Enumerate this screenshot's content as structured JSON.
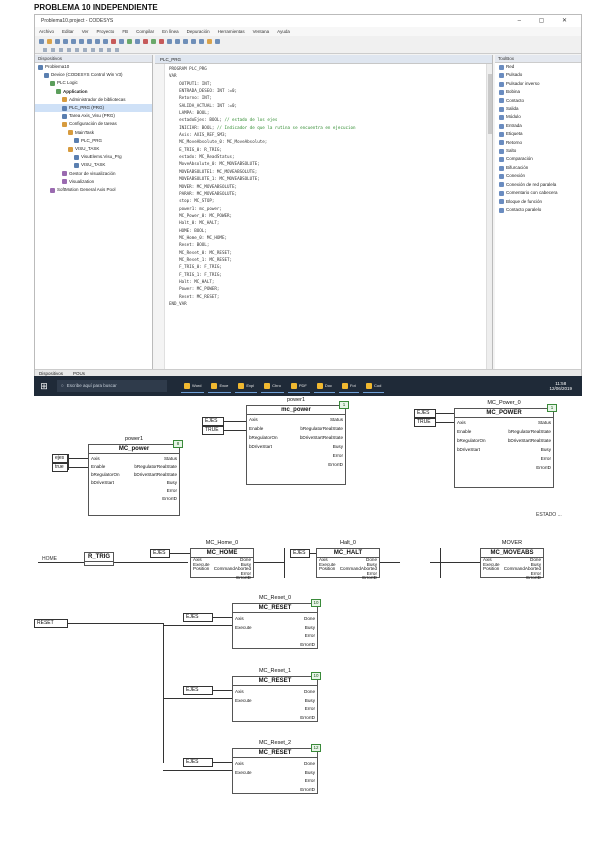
{
  "page_title": "PROBLEMA 10 INDEPENDIENTE",
  "ide": {
    "window_title": "Problema10.project - CODESYS",
    "window_controls": "–  ▢  ✕",
    "menu": [
      "Archivo",
      "Editar",
      "Ver",
      "Proyecto",
      "FB",
      "Compilar",
      "En línea",
      "Depuración",
      "Herramientas",
      "Ventana",
      "Ayuda"
    ],
    "devices_header": "Dispositivos",
    "tree": [
      {
        "label": "Problema10",
        "indent": 0,
        "icon": "project-icon",
        "bold": false
      },
      {
        "label": "Device (CODESYS Control Win V3)",
        "indent": 1,
        "icon": "plc-icon",
        "bold": false
      },
      {
        "label": "PLC Logic",
        "indent": 2,
        "icon": "logic-icon",
        "bold": false
      },
      {
        "label": "Application",
        "indent": 3,
        "icon": "app-icon",
        "bold": true
      },
      {
        "label": "Administrador de bibliotecas",
        "indent": 4,
        "icon": "library-icon",
        "bold": false
      },
      {
        "label": "PLC_PRG (PRG)",
        "indent": 4,
        "icon": "program-icon",
        "bold": false,
        "selected": true
      },
      {
        "label": "Tarea Axis_Visu (PRG)",
        "indent": 4,
        "icon": "program-icon",
        "bold": false
      },
      {
        "label": "Configuración de tareas",
        "indent": 4,
        "icon": "task-icon",
        "bold": false
      },
      {
        "label": "MainTask",
        "indent": 5,
        "icon": "task-icon",
        "bold": false
      },
      {
        "label": "PLC_PRG",
        "indent": 6,
        "icon": "program-icon",
        "bold": false
      },
      {
        "label": "VISU_TASK",
        "indent": 5,
        "icon": "task-icon",
        "bold": false
      },
      {
        "label": "VisuElems.Visu_Prg",
        "indent": 6,
        "icon": "program-icon",
        "bold": false
      },
      {
        "label": "VISU_TASK",
        "indent": 6,
        "icon": "program-icon",
        "bold": false
      },
      {
        "label": "Gestor de visualización",
        "indent": 4,
        "icon": "visu-icon",
        "bold": false
      },
      {
        "label": "Visualization",
        "indent": 4,
        "icon": "visu-icon",
        "bold": false
      },
      {
        "label": "SoftMotion General Axis Pool",
        "indent": 2,
        "icon": "axis-icon",
        "bold": false
      }
    ],
    "editor_tab": "PLC_PRG",
    "code_lines": [
      {
        "n": "1",
        "t": "PROGRAM PLC_PRG",
        "c": ""
      },
      {
        "n": "2",
        "t": "VAR",
        "c": ""
      },
      {
        "n": "3",
        "t": "    OUTPUT1: INT;",
        "c": ""
      },
      {
        "n": "4",
        "t": "    ENTRADA_DESEO: INT :=0;",
        "c": ""
      },
      {
        "n": "5",
        "t": "    Retorno: INT;",
        "c": ""
      },
      {
        "n": "6",
        "t": "    SALIDA_ACTUAL: INT :=0;",
        "c": ""
      },
      {
        "n": "7",
        "t": "    LAMPA: BOOL;",
        "c": ""
      },
      {
        "n": "8",
        "t": "    estadoEjes: BOOL;",
        "c": " // estado de los ejes"
      },
      {
        "n": "9",
        "t": "    INICIAR: BOOL;",
        "c": " // Indicador de que la rutina se encuentra en ejecucion"
      },
      {
        "n": "10",
        "t": "    Axis: AXIS_REF_SM3;",
        "c": ""
      },
      {
        "n": "11",
        "t": "    MC_MoveAbsolute_0: MC_MoveAbsolute;",
        "c": ""
      },
      {
        "n": "12",
        "t": "    E_TRIG_0: R_TRIG;",
        "c": ""
      },
      {
        "n": "13",
        "t": "    estado: MC_ReadStatus;",
        "c": ""
      },
      {
        "n": "14",
        "t": "    MoveAbsolute_0: MC_MOVEABSOLUTE;",
        "c": ""
      },
      {
        "n": "15",
        "t": "    MOVEABSOLUTE1: MC_MOVEABSOLUTE;",
        "c": ""
      },
      {
        "n": "16",
        "t": "    MOVEABSOLUTE_1: MC_MOVEABSOLUTE;",
        "c": ""
      },
      {
        "n": "17",
        "t": "    MOVER: MC_MOVEABSOLUTE;",
        "c": ""
      },
      {
        "n": "18",
        "t": "    PARAR: MC_MOVEABSOLUTE;",
        "c": ""
      },
      {
        "n": "19",
        "t": "    stop: MC_STOP;",
        "c": ""
      },
      {
        "n": "20",
        "t": "    power1: mc_power;",
        "c": ""
      },
      {
        "n": "21",
        "t": "    MC_Power_0: MC_POWER;",
        "c": ""
      },
      {
        "n": "22",
        "t": "    Halt_0: MC_HALT;",
        "c": ""
      },
      {
        "n": "23",
        "t": "    HOME: BOOL;",
        "c": ""
      },
      {
        "n": "24",
        "t": "    MC_Home_0: MC_HOME;",
        "c": ""
      },
      {
        "n": "25",
        "t": "    Reset: BOOL;",
        "c": ""
      },
      {
        "n": "26",
        "t": "    MC_Reset_0: MC_RESET;",
        "c": ""
      },
      {
        "n": "27",
        "t": "    MC_Reset_1: MC_RESET;",
        "c": ""
      },
      {
        "n": "28",
        "t": "    F_TRIG_0: F_TRIG;",
        "c": ""
      },
      {
        "n": "29",
        "t": "    F_TRIG_1: F_TRIG;",
        "c": ""
      },
      {
        "n": "30",
        "t": "    Halt: MC_HALT;",
        "c": ""
      },
      {
        "n": "31",
        "t": "    Power: MC_POWER;",
        "c": ""
      },
      {
        "n": "32",
        "t": "    Reset: MC_RESET;",
        "c": ""
      },
      {
        "n": "33",
        "t": "END_VAR",
        "c": ""
      }
    ],
    "toolbox_header": "ToolBox",
    "toolbox": [
      "Red",
      "Pulsado",
      "Pulsador inverso",
      "Bobina",
      "Contacto",
      "Salida",
      "Módulo",
      "Entrada",
      "Etiqueta",
      "Retorno",
      "Salto",
      "Comparación",
      "Bifurcación",
      "Conexión",
      "Conexión de red paralela",
      "Comentario con cabecera",
      "Bloque de función",
      "Contacto paralelo"
    ],
    "pane_tabs": [
      "Dispositivos",
      "POUs"
    ],
    "status_items": [
      "Mensajes · Total 0 error(es), 0 advertencia(s), 0 mensaje(s)",
      "Último compilado: 0  0",
      "Precompilado ✓",
      "Usuario del proyecto: (nadie)",
      "INS",
      "Ln 1   Col 1   Ch 1"
    ]
  },
  "taskbar": {
    "search_placeholder": "Escribe aquí para buscar",
    "apps": [
      "Word",
      "Exce",
      "Expl",
      "Chro",
      "PDF",
      "Doc",
      "Fot",
      "Cod"
    ],
    "clock_time": "11:58",
    "clock_date": "12/06/2019"
  },
  "diagrams": {
    "row1": {
      "power1": {
        "instance": "power1",
        "type": "MC_power",
        "badge": "8",
        "inputs": [
          "Axis",
          "Enable",
          "bRegulatorOn",
          "bDriveStart"
        ],
        "outputs": [
          "Status",
          "bRegulatorRealState",
          "bDriveStartRealState",
          "Busy",
          "Error",
          "ErrorID"
        ],
        "vars": [
          "ejes",
          "true"
        ]
      },
      "power1b": {
        "instance": "power1",
        "type": "mc_power",
        "badge": "1",
        "inputs": [
          "Axis",
          "Enable",
          "bRegulatorOn",
          "bDriveStart"
        ],
        "outputs": [
          "Status",
          "bRegulatorRealState",
          "bDriveStartRealState",
          "Busy",
          "Error",
          "ErrorID"
        ],
        "vars": [
          "EJES",
          "TRUE"
        ]
      },
      "power0": {
        "instance": "MC_Power_0",
        "type": "MC_POWER",
        "badge": "1",
        "inputs": [
          "Axis",
          "Enable",
          "bRegulatorOn",
          "bDriveStart"
        ],
        "outputs": [
          "Status",
          "bRegulatorRealState",
          "bDriveStartRealState",
          "Busy",
          "Error",
          "ErrorID"
        ],
        "vars": [
          "EJES",
          "TRUE"
        ]
      },
      "note": "ESTADO ..."
    },
    "row2": {
      "b1": {
        "instance": "MC_Home_0",
        "type": "MC_HOME"
      },
      "b2": {
        "instance": "Halt_0",
        "type": "MC_HALT"
      },
      "b3": {
        "instance": "stop",
        "type": "MC_STOP"
      },
      "b4": {
        "instance": "MOVER",
        "type": "MC_MOVEABS"
      },
      "pins_in": [
        "Axis",
        "Execute",
        "Position"
      ],
      "pins_out": [
        "Done",
        "Busy",
        "CommandAborted",
        "Error",
        "ErrorID"
      ],
      "labels": [
        "HOME",
        "R_TRIG",
        "EJES",
        "EJES"
      ]
    },
    "resets": [
      {
        "instance": "MC_Reset_0",
        "type": "MC_RESET",
        "badge": "10",
        "var": "EJES"
      },
      {
        "instance": "MC_Reset_1",
        "type": "MC_RESET",
        "badge": "10",
        "var": "EJES"
      },
      {
        "instance": "MC_Reset_2",
        "type": "MC_RESET",
        "badge": "12",
        "var": "EJES"
      }
    ],
    "reset_inputs": [
      "Axis",
      "Execute"
    ],
    "reset_outputs": [
      "Done",
      "Busy",
      "Error",
      "ErrorID"
    ],
    "reset_var": "RESET"
  }
}
